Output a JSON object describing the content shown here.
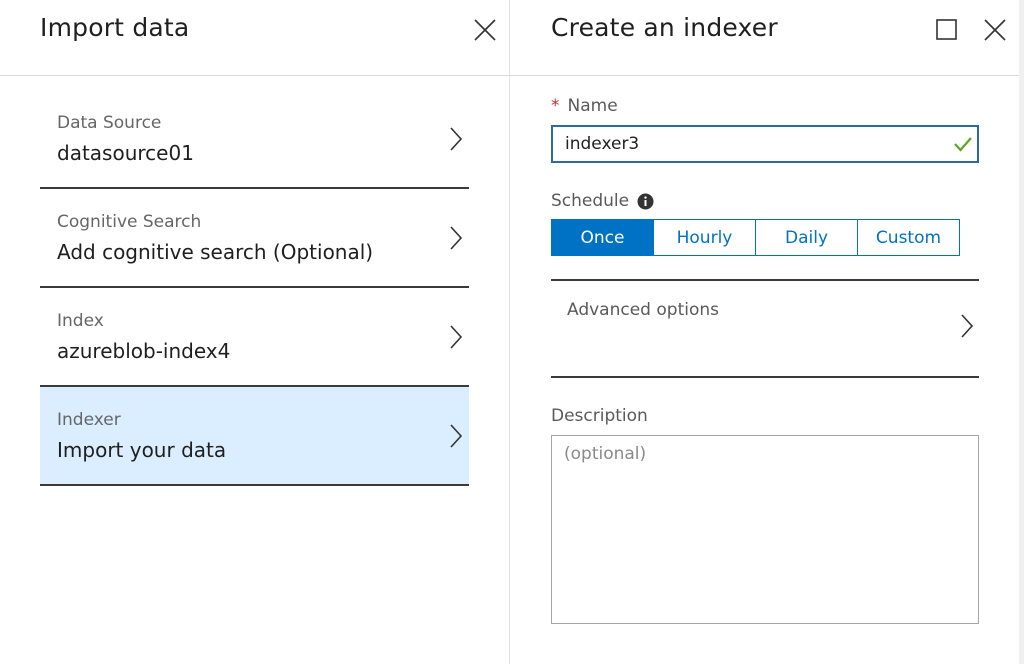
{
  "left_blade": {
    "title": "Import data",
    "steps": [
      {
        "label": "Data Source",
        "value": "datasource01"
      },
      {
        "label": "Cognitive Search",
        "value": "Add cognitive search (Optional)"
      },
      {
        "label": "Index",
        "value": "azureblob-index4"
      },
      {
        "label": "Indexer",
        "value": "Import your data"
      }
    ]
  },
  "right_blade": {
    "title": "Create an indexer",
    "name_field": {
      "required_marker": "*",
      "label": "Name",
      "value": "indexer3"
    },
    "schedule": {
      "label": "Schedule",
      "options": [
        "Once",
        "Hourly",
        "Daily",
        "Custom"
      ],
      "selected": "Once"
    },
    "advanced_options": {
      "label": "Advanced options"
    },
    "description": {
      "label": "Description",
      "placeholder": "(optional)"
    }
  },
  "colors": {
    "accent": "#0072c6",
    "selected_step_bg": "#daeeff",
    "input_border": "#2b6c9f",
    "valid_check": "#5ba51e",
    "required": "#c0302b"
  },
  "icons": {
    "close": "close-icon",
    "maximize": "maximize-icon",
    "chevron": "chevron-right-icon",
    "check": "checkmark-icon",
    "info": "info-icon"
  }
}
